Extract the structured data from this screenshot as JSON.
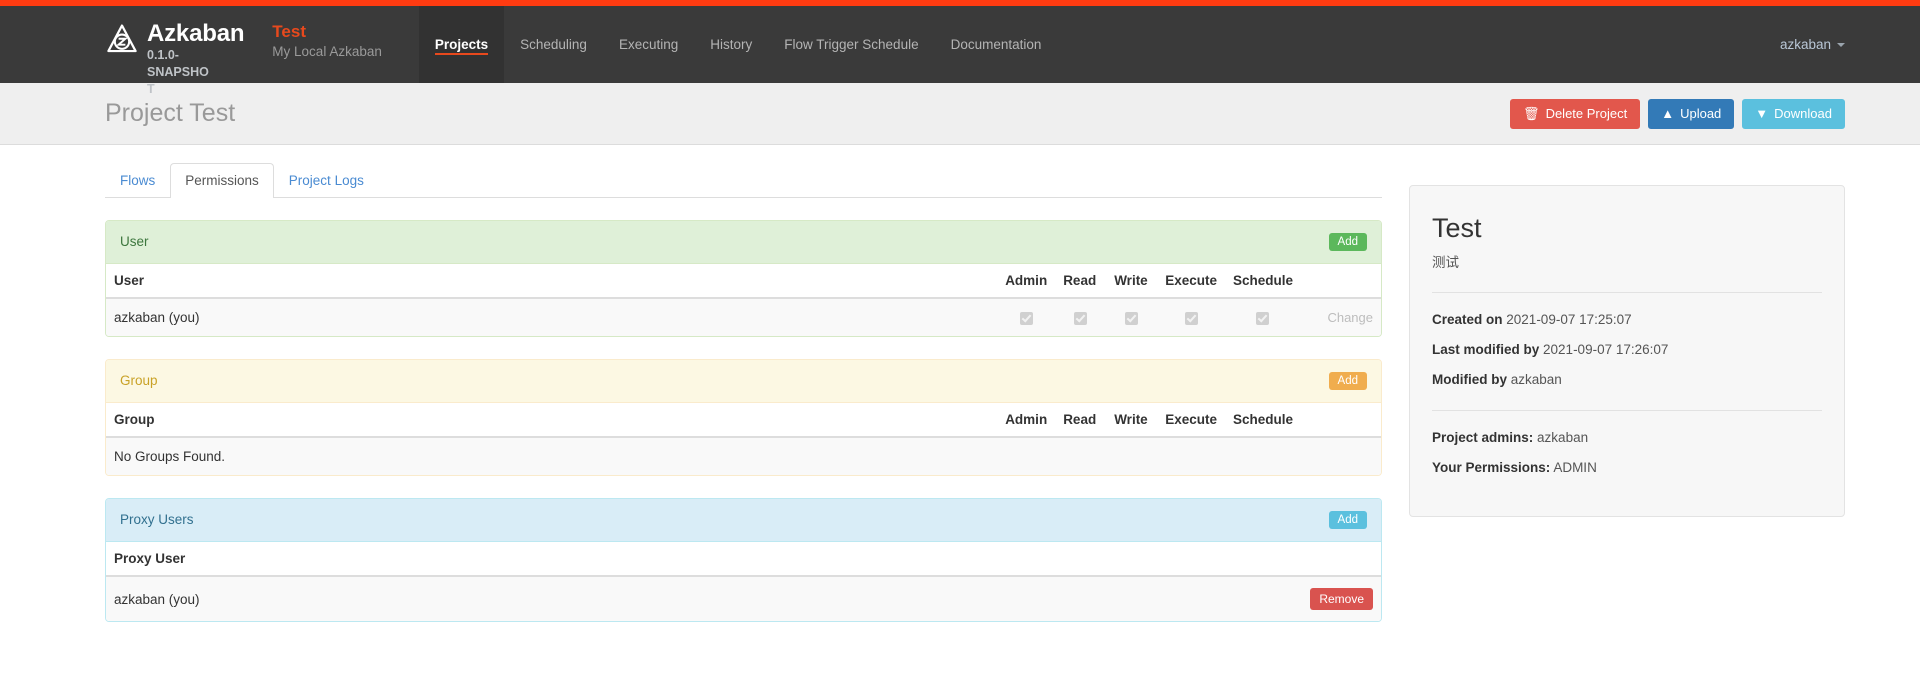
{
  "brand": {
    "name": "Azkaban",
    "version": "0.1.0-SNAPSHOT",
    "project_name": "Test",
    "project_sub": "My Local Azkaban",
    "logo_icon": "azkaban-triangle-z-logo"
  },
  "nav": {
    "items": [
      {
        "label": "Projects",
        "active": true
      },
      {
        "label": "Scheduling",
        "active": false
      },
      {
        "label": "Executing",
        "active": false
      },
      {
        "label": "History",
        "active": false
      },
      {
        "label": "Flow Trigger Schedule",
        "active": false
      },
      {
        "label": "Documentation",
        "active": false
      }
    ],
    "user": "azkaban"
  },
  "header": {
    "title": "Project Test",
    "buttons": {
      "delete": {
        "label": "Delete Project",
        "icon": "trash-icon",
        "color": "#e2574c"
      },
      "upload": {
        "label": "Upload",
        "icon": "upload-circle-icon",
        "color": "#337ab7"
      },
      "download": {
        "label": "Download",
        "icon": "download-circle-icon",
        "color": "#5bc0de"
      }
    }
  },
  "tabs": [
    {
      "label": "Flows",
      "active": false
    },
    {
      "label": "Permissions",
      "active": true
    },
    {
      "label": "Project Logs",
      "active": false
    }
  ],
  "panels": {
    "user": {
      "title": "User",
      "add_label": "Add",
      "accent": "#5cb85c",
      "columns": [
        "User",
        "Admin",
        "Read",
        "Write",
        "Execute",
        "Schedule"
      ],
      "rows": [
        {
          "name": "azkaban (you)",
          "admin": true,
          "read": true,
          "write": true,
          "execute": true,
          "schedule": true,
          "action_label": "Change"
        }
      ]
    },
    "group": {
      "title": "Group",
      "add_label": "Add",
      "accent": "#f0ad4e",
      "columns": [
        "Group",
        "Admin",
        "Read",
        "Write",
        "Execute",
        "Schedule"
      ],
      "empty_text": "No Groups Found."
    },
    "proxy": {
      "title": "Proxy Users",
      "add_label": "Add",
      "accent": "#5bc0de",
      "columns": [
        "Proxy User"
      ],
      "rows": [
        {
          "name": "azkaban (you)",
          "action_label": "Remove"
        }
      ]
    }
  },
  "sidebar": {
    "title": "Test",
    "subtitle": "测试",
    "created_label": "Created on",
    "created_value": "2021-09-07 17:25:07",
    "modified_label": "Last modified by",
    "modified_value": "2021-09-07 17:26:07",
    "modified_by_label": "Modified by",
    "modified_by_value": "azkaban",
    "admins_label": "Project admins:",
    "admins_value": "azkaban",
    "permissions_label": "Your Permissions:",
    "permissions_value": "ADMIN"
  }
}
